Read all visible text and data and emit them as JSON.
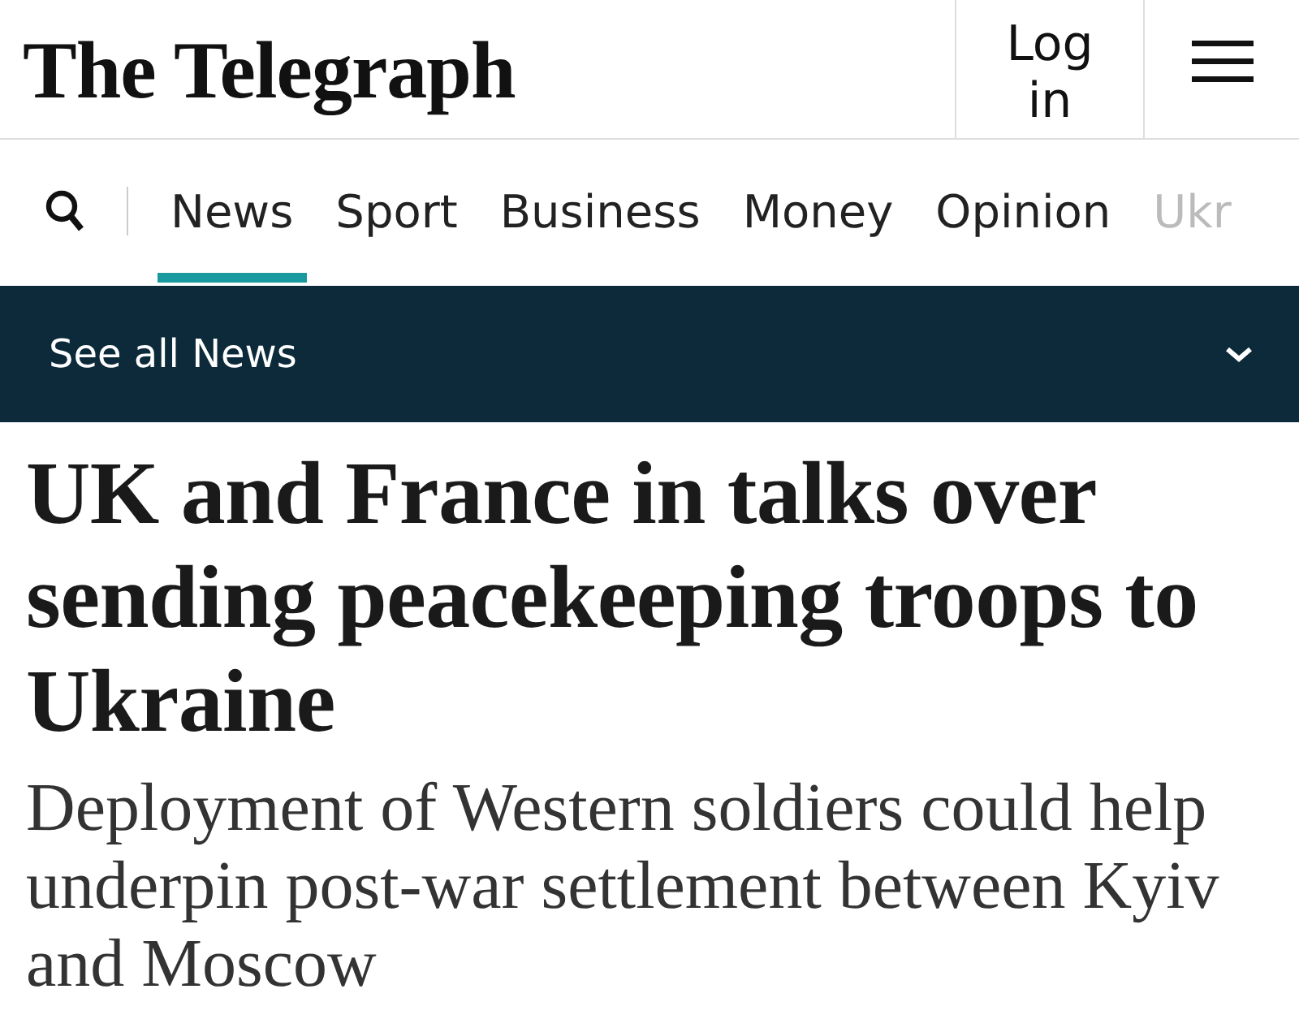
{
  "header": {
    "logo": "The Telegraph",
    "login": "Log in"
  },
  "nav": {
    "tabs": [
      {
        "label": "News",
        "selected": true
      },
      {
        "label": "Sport",
        "selected": false
      },
      {
        "label": "Business",
        "selected": false
      },
      {
        "label": "Money",
        "selected": false
      },
      {
        "label": "Opinion",
        "selected": false
      },
      {
        "label": "Ukr",
        "selected": false
      }
    ]
  },
  "section_bar": {
    "label": "See all News",
    "expanded": false
  },
  "article": {
    "headline": "UK and France in talks over sending peacekeeping troops to Ukraine",
    "standfirst": "Deployment of Western soldiers could help underpin post-war settlement between Kyiv and Moscow"
  }
}
